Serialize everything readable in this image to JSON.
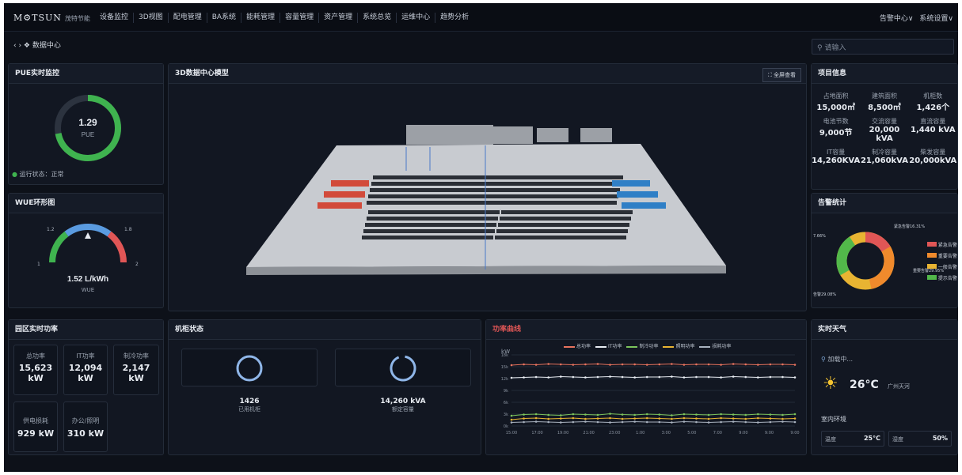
{
  "nav": {
    "logo": "M⚙TSUN",
    "logo_sub": "茂特节能",
    "menu": [
      "设备监控",
      "3D视图",
      "配电管理",
      "BA系统",
      "能耗管理",
      "容量管理",
      "资产管理",
      "系统总览",
      "运维中心",
      "趋势分析"
    ],
    "alarm_center": "告警中心∨",
    "settings": "系统设置∨"
  },
  "breadcrumb": "‹ › ❖ 数据中心",
  "search": {
    "placeholder": "请输入"
  },
  "pue": {
    "title": "PUE实时监控",
    "value": "1.29",
    "label": "PUE",
    "status": "运行状态：正常",
    "fill": 0.72,
    "color": "#3fb34f"
  },
  "wue": {
    "title": "WUE环形图",
    "value": "1.52 L/kWh",
    "label": "WUE",
    "ticks": [
      "1",
      "1.2",
      "1.8",
      "2"
    ]
  },
  "model": {
    "title": "3D数据中心模型",
    "fullscreen": "⛶ 全屏查看"
  },
  "project": {
    "title": "项目信息",
    "items": [
      {
        "label": "占地面积",
        "value": "15,000㎡"
      },
      {
        "label": "建筑面积",
        "value": "8,500㎡"
      },
      {
        "label": "机柜数",
        "value": "1,426个"
      },
      {
        "label": "电池节数",
        "value": "9,000节"
      },
      {
        "label": "交流容量",
        "value": "20,000 kVA"
      },
      {
        "label": "直流容量",
        "value": "1,440 kVA"
      },
      {
        "label": "IT容量",
        "value": "14,260KVA"
      },
      {
        "label": "制冷容量",
        "value": "21,060kVA"
      },
      {
        "label": "柴发容量",
        "value": "20,000kVA"
      }
    ]
  },
  "alarm": {
    "title": "告警统计",
    "top_label": "紧急告警16.31%",
    "left_label": "7.66%",
    "right_label": "重要告警29.95%",
    "bottom_label": "告警29.08%",
    "legend": [
      {
        "name": "紧急告警",
        "color": "#e05656"
      },
      {
        "name": "重要告警",
        "color": "#f08a2c"
      },
      {
        "name": "一般告警",
        "color": "#e8b432"
      },
      {
        "name": "提示告警",
        "color": "#52b84a"
      }
    ]
  },
  "park_power": {
    "title": "园区实时功率",
    "items": [
      {
        "label": "总功率",
        "value": "15,623",
        "unit": "kW"
      },
      {
        "label": "IT功率",
        "value": "12,094",
        "unit": "kW"
      },
      {
        "label": "制冷功率",
        "value": "2,147",
        "unit": "kW"
      },
      {
        "label": "供电损耗",
        "value": "929 kW"
      },
      {
        "label": "办公/照明",
        "value": "310 kW"
      }
    ]
  },
  "cabinet": {
    "title": "机柜状态",
    "items": [
      {
        "value": "1426",
        "label": "已用机柜"
      },
      {
        "value": "14,260 kVA",
        "label": "额定容量"
      }
    ]
  },
  "weather": {
    "title": "实时天气",
    "loading": "加载中...",
    "temp": "26°C",
    "city": "广州天河",
    "indoor_title": "室内环境",
    "indoor": [
      {
        "label": "温度",
        "value": "25°C"
      },
      {
        "label": "湿度",
        "value": "50%"
      }
    ]
  },
  "chart_data": {
    "type": "line",
    "title": "功率曲线",
    "ylabel": "kW",
    "ylim": [
      0,
      18
    ],
    "yticks": [
      "18k",
      "15k",
      "12k",
      "9k",
      "6k",
      "3k",
      "0k"
    ],
    "x": [
      "15:00",
      "17:00",
      "19:00",
      "21:00",
      "23:00",
      "1:00",
      "3:00",
      "5:00",
      "7:00",
      "9:00",
      "9:00",
      "9:00"
    ],
    "series": [
      {
        "name": "总功率",
        "color": "#e8735e",
        "values": [
          15.4,
          15.6,
          15.5,
          15.7,
          15.6,
          15.5,
          15.6,
          15.7,
          15.5,
          15.6,
          15.6,
          15.5,
          15.6,
          15.7,
          15.5,
          15.6,
          15.6,
          15.5,
          15.7,
          15.6,
          15.5,
          15.6,
          15.6,
          15.5
        ]
      },
      {
        "name": "IT功率",
        "color": "#e8ecf2",
        "values": [
          12.2,
          12.3,
          12.4,
          12.3,
          12.5,
          12.4,
          12.3,
          12.4,
          12.5,
          12.4,
          12.3,
          12.4,
          12.4,
          12.5,
          12.3,
          12.4,
          12.4,
          12.3,
          12.5,
          12.4,
          12.3,
          12.4,
          12.4,
          12.3
        ]
      },
      {
        "name": "制冷功率",
        "color": "#7cc45c",
        "values": [
          2.6,
          2.9,
          3.0,
          2.8,
          2.7,
          3.0,
          2.9,
          2.8,
          3.1,
          2.9,
          2.8,
          3.0,
          2.9,
          2.7,
          3.0,
          2.9,
          2.8,
          3.0,
          2.9,
          2.8,
          3.0,
          2.9,
          2.8,
          3.0
        ]
      },
      {
        "name": "照明功率",
        "color": "#e8b432",
        "values": [
          1.6,
          1.9,
          2.0,
          1.8,
          1.9,
          2.0,
          1.8,
          1.9,
          2.0,
          1.8,
          1.9,
          2.0,
          1.9,
          1.8,
          2.0,
          1.9,
          1.8,
          2.0,
          1.9,
          1.8,
          2.0,
          1.9,
          1.8,
          1.9
        ]
      },
      {
        "name": "损耗功率",
        "color": "#a9b2bf",
        "values": [
          0.9,
          1.0,
          1.1,
          1.0,
          0.9,
          1.0,
          1.1,
          1.0,
          0.9,
          1.0,
          1.1,
          1.0,
          1.0,
          0.9,
          1.1,
          1.0,
          0.9,
          1.0,
          1.1,
          1.0,
          0.9,
          1.0,
          1.1,
          1.0
        ]
      }
    ]
  }
}
